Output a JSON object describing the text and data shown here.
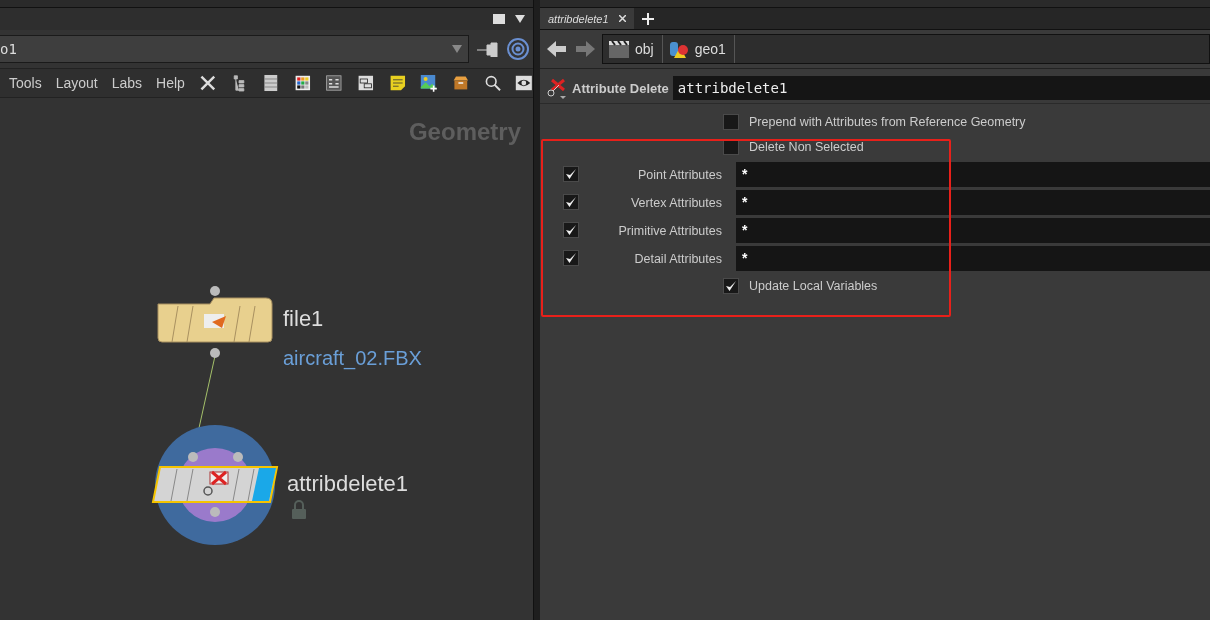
{
  "left_pane": {
    "path": "o1",
    "menu": [
      "Tools",
      "Layout",
      "Labs",
      "Help"
    ],
    "network": {
      "context_label": "Geometry",
      "nodes": [
        {
          "kind": "file",
          "name": "file1",
          "detail": "aircraft_02.FBX",
          "selected": false
        },
        {
          "kind": "attribdelete",
          "name": "attribdelete1",
          "selected": true,
          "locked": true
        }
      ]
    }
  },
  "right_pane": {
    "tabs": [
      {
        "label": "attribdelete1",
        "selected": true
      }
    ],
    "breadcrumbs": [
      "obj",
      "geo1"
    ],
    "node_type": "Attribute Delete",
    "node_name": "attribdelete1",
    "parameters": [
      {
        "kind": "toggle",
        "label": "Prepend with Attributes from Reference Geometry",
        "checked": false
      },
      {
        "kind": "toggle",
        "label": "Delete Non Selected",
        "checked": false
      },
      {
        "kind": "pattern",
        "label": "Point Attributes",
        "checked": true,
        "value": "*"
      },
      {
        "kind": "pattern",
        "label": "Vertex Attributes",
        "checked": true,
        "value": "*"
      },
      {
        "kind": "pattern",
        "label": "Primitive Attributes",
        "checked": true,
        "value": "*"
      },
      {
        "kind": "pattern",
        "label": "Detail Attributes",
        "checked": true,
        "value": "*"
      },
      {
        "kind": "toggle",
        "label": "Update Local Variables",
        "checked": true
      }
    ]
  }
}
